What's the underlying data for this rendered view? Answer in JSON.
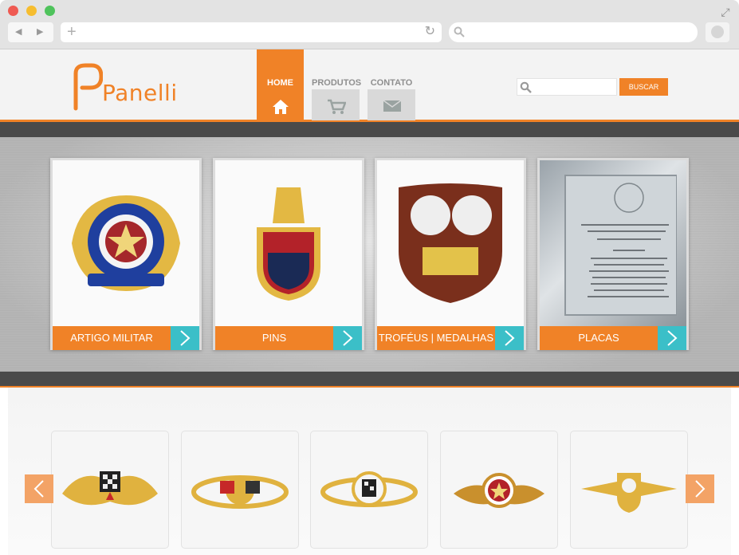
{
  "site": {
    "logo_text": "Panelli"
  },
  "nav": {
    "home": "HOME",
    "produtos": "PRODUTOS",
    "contato": "CONTATO"
  },
  "search": {
    "placeholder": "",
    "button": "BUSCAR"
  },
  "categories": [
    {
      "label": "ARTIGO MILITAR"
    },
    {
      "label": "PINS"
    },
    {
      "label": "TROFÉUS | MEDALHAS"
    },
    {
      "label": "PLACAS"
    }
  ],
  "colors": {
    "accent": "#f08227",
    "teal": "#3bbfc8",
    "dark_band": "#4a4a4a"
  }
}
